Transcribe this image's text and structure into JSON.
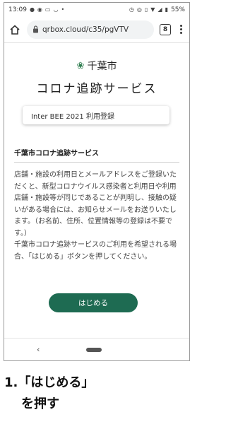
{
  "status_bar": {
    "time": "13:09",
    "battery": "55%",
    "left_icons": [
      "chat-icon",
      "notification-icon",
      "cast-icon",
      "wifi-icon",
      "dot-icon"
    ],
    "right_icons": [
      "alarm-icon",
      "location-icon",
      "vibrate-icon",
      "wifi-signal-icon",
      "cell-signal-icon",
      "battery-icon"
    ]
  },
  "browser": {
    "url": "qrbox.cloud/c35/pgVTV",
    "tab_count": "8"
  },
  "page": {
    "city_name": "千葉市",
    "service_title": "コロナ追跡サービス",
    "event_label": "Inter BEE 2021 利用登録",
    "section_title": "千葉市コロナ追跡サービス",
    "body_text": "店舗・施設の利用日とメールアドレスをご登録いただくと、新型コロナウイルス感染者と利用日や利用店舗・施設等が同じであることが判明し、接触の疑いがある場合には、お知らせメールをお送りいたします。（お名前、住所、位置情報等の登録は不要です。）\n千葉市コロナ追跡サービスのご利用を希望される場合、「はじめる」ボタンを押してください。",
    "start_button": "はじめる"
  },
  "nav": {
    "back": "‹"
  },
  "caption": {
    "line1": "1.「はじめる」",
    "line2": "を押す"
  },
  "colors": {
    "accent": "#1e6b52",
    "logo": "#2e7d4f"
  }
}
